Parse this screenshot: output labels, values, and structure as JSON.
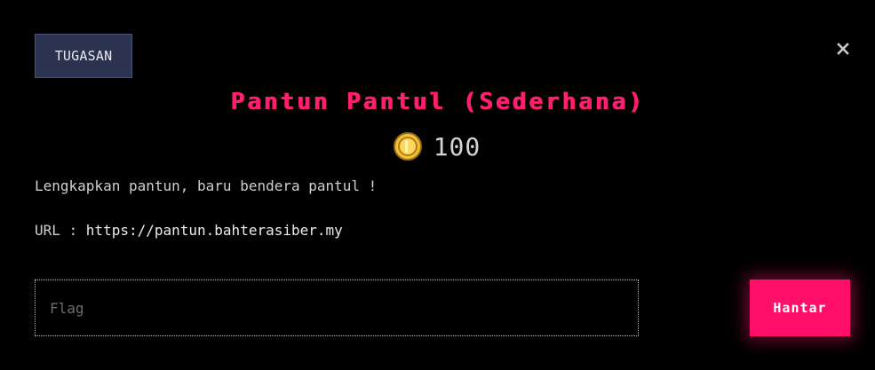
{
  "modal": {
    "tab_label": "TUGASAN",
    "close_icon": "close-icon",
    "title": "Pantun Pantul (Sederhana)",
    "points": {
      "icon": "coin-icon",
      "value": "100"
    },
    "description": "Lengkapkan pantun, baru bendera pantul !",
    "url": {
      "label": "URL : ",
      "link": "https://pantun.bahterasiber.my"
    },
    "flag_input": {
      "value": "",
      "placeholder": "Flag"
    },
    "submit_label": "Hantar"
  },
  "colors": {
    "background": "#000000",
    "accent": "#ff1f6e",
    "button": "#ff0f6a",
    "tab": "#2c3350",
    "coin": "#f2c23a"
  }
}
